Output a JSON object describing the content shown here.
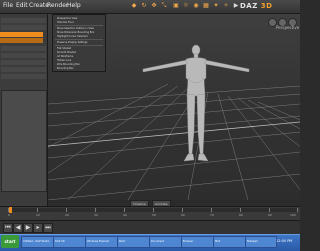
{
  "app": {
    "brand_name": "DAZ",
    "brand_suffix": "3D",
    "menu": [
      "File",
      "Edit",
      "Create",
      "Render",
      "Help"
    ],
    "toolbar_icons": [
      "select-icon",
      "rotate-icon",
      "translate-icon",
      "scale-icon",
      "spot-render-icon",
      "light-icon",
      "camera-icon",
      "grid-icon",
      "morph-icon",
      "pose-icon",
      "render-icon"
    ]
  },
  "context_menu": {
    "items": [
      "Perspective View",
      "Hide the Floor",
      "Show Selection Outline in View",
      "Show Dimension Bounding Box",
      "Highlight Cursor Selected",
      "Preserve Display Settings",
      "Flat Shaded",
      "Smooth Shaded",
      "Lit Wireframe",
      "Hidden Line",
      "Wire Bounding Box",
      "Bounding Box"
    ]
  },
  "viewport": {
    "label": "Perspective"
  },
  "bottom_tabs": [
    "Timeline",
    "Animate"
  ],
  "timeline": {
    "labels": [
      "0",
      "10",
      "20",
      "30",
      "40",
      "50",
      "60",
      "70",
      "80",
      "90",
      "100"
    ]
  },
  "taskbar": {
    "start_label": "start",
    "items": [
      "Untitled - DAZ Studio",
      "DAZ 3D",
      "Windows Explorer",
      "Paint",
      "Document",
      "Browser",
      "Mail",
      "Notepad"
    ],
    "clock": "12:00 PM"
  },
  "colors": {
    "accent": "#f08c1e",
    "viewport_bg": "#333333",
    "taskbar": "#2a5aa8"
  }
}
